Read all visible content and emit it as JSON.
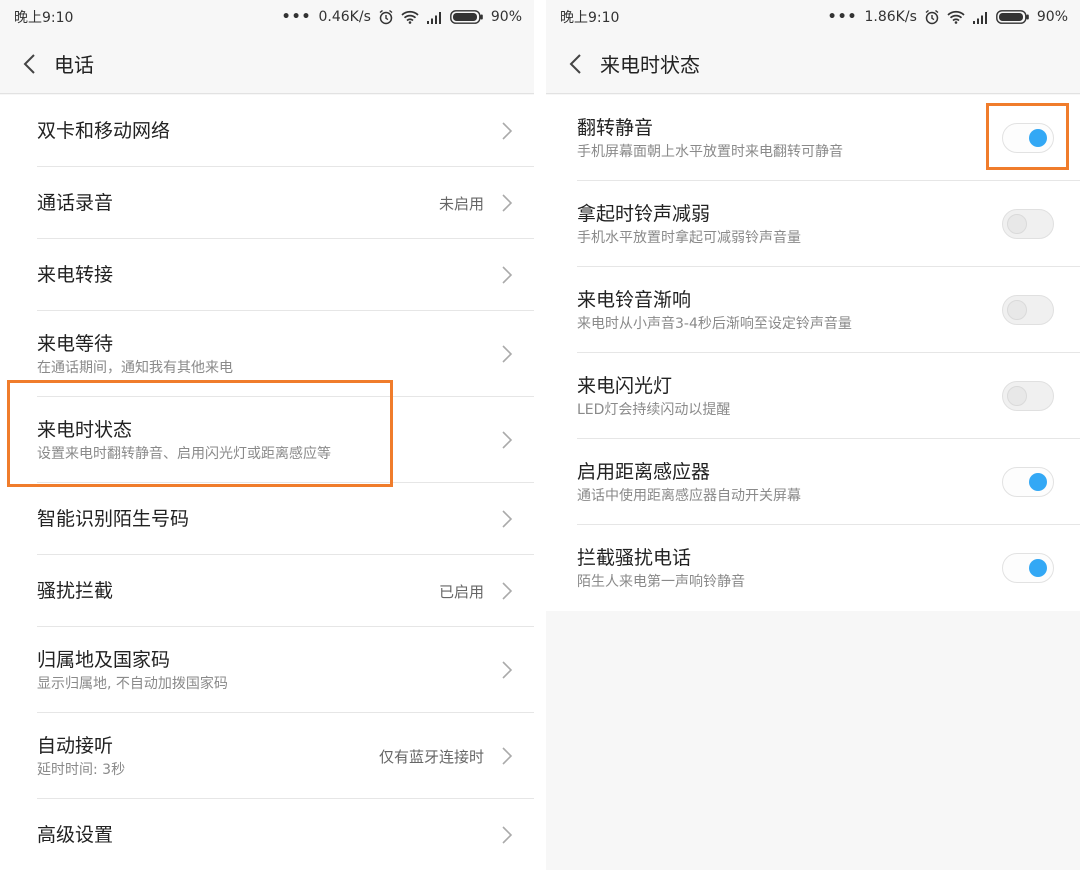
{
  "left_screen": {
    "status_bar": {
      "time": "晚上9:10",
      "speed": "0.46K/s",
      "battery": "90%"
    },
    "header": {
      "title": "电话"
    },
    "items": [
      {
        "label": "双卡和移动网络"
      },
      {
        "label": "通话录音",
        "value": "未启用"
      },
      {
        "label": "来电转接"
      },
      {
        "label": "来电等待",
        "subtitle": "在通话期间，通知我有其他来电"
      },
      {
        "label": "来电时状态",
        "subtitle": "设置来电时翻转静音、启用闪光灯或距离感应等"
      },
      {
        "label": "智能识别陌生号码"
      },
      {
        "label": "骚扰拦截",
        "value": "已启用"
      },
      {
        "label": "归属地及国家码",
        "subtitle": "显示归属地, 不自动加拨国家码"
      },
      {
        "label": "自动接听",
        "subtitle": "延时时间: 3秒",
        "value": "仅有蓝牙连接时"
      },
      {
        "label": "高级设置"
      }
    ]
  },
  "right_screen": {
    "status_bar": {
      "time": "晚上9:10",
      "speed": "1.86K/s",
      "battery": "90%"
    },
    "header": {
      "title": "来电时状态"
    },
    "items": [
      {
        "label": "翻转静音",
        "subtitle": "手机屏幕面朝上水平放置时来电翻转可静音",
        "enabled": true
      },
      {
        "label": "拿起时铃声减弱",
        "subtitle": "手机水平放置时拿起可减弱铃声音量",
        "enabled": false
      },
      {
        "label": "来电铃音渐响",
        "subtitle": "来电时从小声音3-4秒后渐响至设定铃声音量",
        "enabled": false
      },
      {
        "label": "来电闪光灯",
        "subtitle": "LED灯会持续闪动以提醒",
        "enabled": false
      },
      {
        "label": "启用距离感应器",
        "subtitle": "通话中使用距离感应器自动开关屏幕",
        "enabled": true
      },
      {
        "label": "拦截骚扰电话",
        "subtitle": "陌生人来电第一声响铃静音",
        "enabled": true
      }
    ]
  },
  "colors": {
    "accent": "#33a8f5",
    "highlight": "#f07c2b"
  },
  "icons": [
    "back-arrow-icon",
    "chevron-right-icon",
    "alarm-icon",
    "wifi-icon",
    "signal-icon",
    "battery-icon"
  ]
}
